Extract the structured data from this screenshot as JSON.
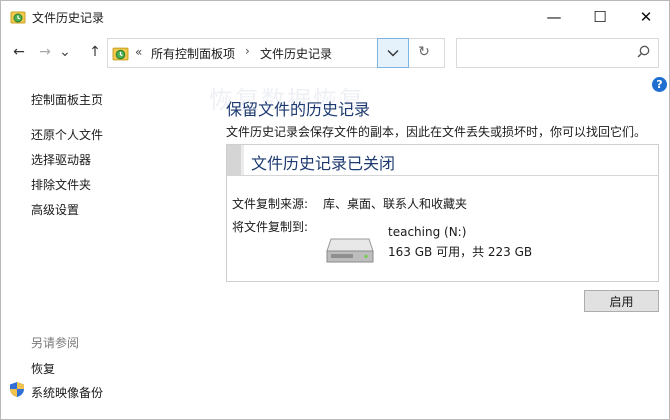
{
  "window": {
    "title": "文件历史记录",
    "minimize": "—",
    "maximize": "☐",
    "close": "✕"
  },
  "nav": {
    "back": "←",
    "forward": "→",
    "recent": "⌄",
    "up": "↑"
  },
  "address": {
    "overflow": "«",
    "crumbs": [
      "所有控制面板项",
      "文件历史记录"
    ],
    "separator": "›",
    "dropdown": "⌄",
    "refresh": "↻"
  },
  "search": {
    "placeholder": "",
    "icon": "⌕"
  },
  "help": {
    "label": "?"
  },
  "sidebar": {
    "items": [
      {
        "label": "控制面板主页"
      },
      {
        "label": "还原个人文件"
      },
      {
        "label": "选择驱动器"
      },
      {
        "label": "排除文件夹"
      },
      {
        "label": "高级设置"
      }
    ],
    "see_also": {
      "heading": "另请参阅",
      "items": [
        {
          "label": "恢复"
        },
        {
          "label": "系统映像备份"
        }
      ]
    }
  },
  "main": {
    "watermark": "恢复数据恢复",
    "title": "保留文件的历史记录",
    "description": "文件历史记录会保存文件的副本，因此在文件丢失或损坏时，你可以找回它们。",
    "status_panel": {
      "heading": "文件历史记录已关闭",
      "source_label": "文件复制来源:",
      "source_value": "库、桌面、联系人和收藏夹",
      "dest_label": "将文件复制到:",
      "drive_name": "teaching (N:)",
      "drive_space": "163 GB 可用，共 223 GB"
    },
    "enable_button": "启用"
  },
  "colors": {
    "heading": "#1c3a70",
    "accent": "#1f6fd0",
    "dropdown_highlight": "#e5f1fb"
  }
}
